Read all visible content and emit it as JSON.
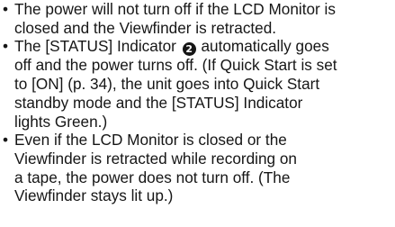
{
  "bullet_symbol": "•",
  "items": [
    {
      "lines": [
        "The power will not turn off if the LCD Monitor is",
        "closed and the Viewfinder is retracted."
      ]
    },
    {
      "line1_before": "The [STATUS] Indicator",
      "badge": "2",
      "line1_after": "automatically goes",
      "lines_rest": [
        "off and the power turns off. (If Quick Start is set",
        "to [ON] (p. 34), the unit goes into Quick Start",
        "standby mode and the [STATUS] Indicator",
        "lights Green.)"
      ]
    },
    {
      "lines": [
        "Even if the LCD Monitor is closed or the",
        "Viewfinder is retracted while recording on",
        "a tape, the power does not turn off. (The",
        "Viewfinder stays lit up.)"
      ]
    }
  ]
}
